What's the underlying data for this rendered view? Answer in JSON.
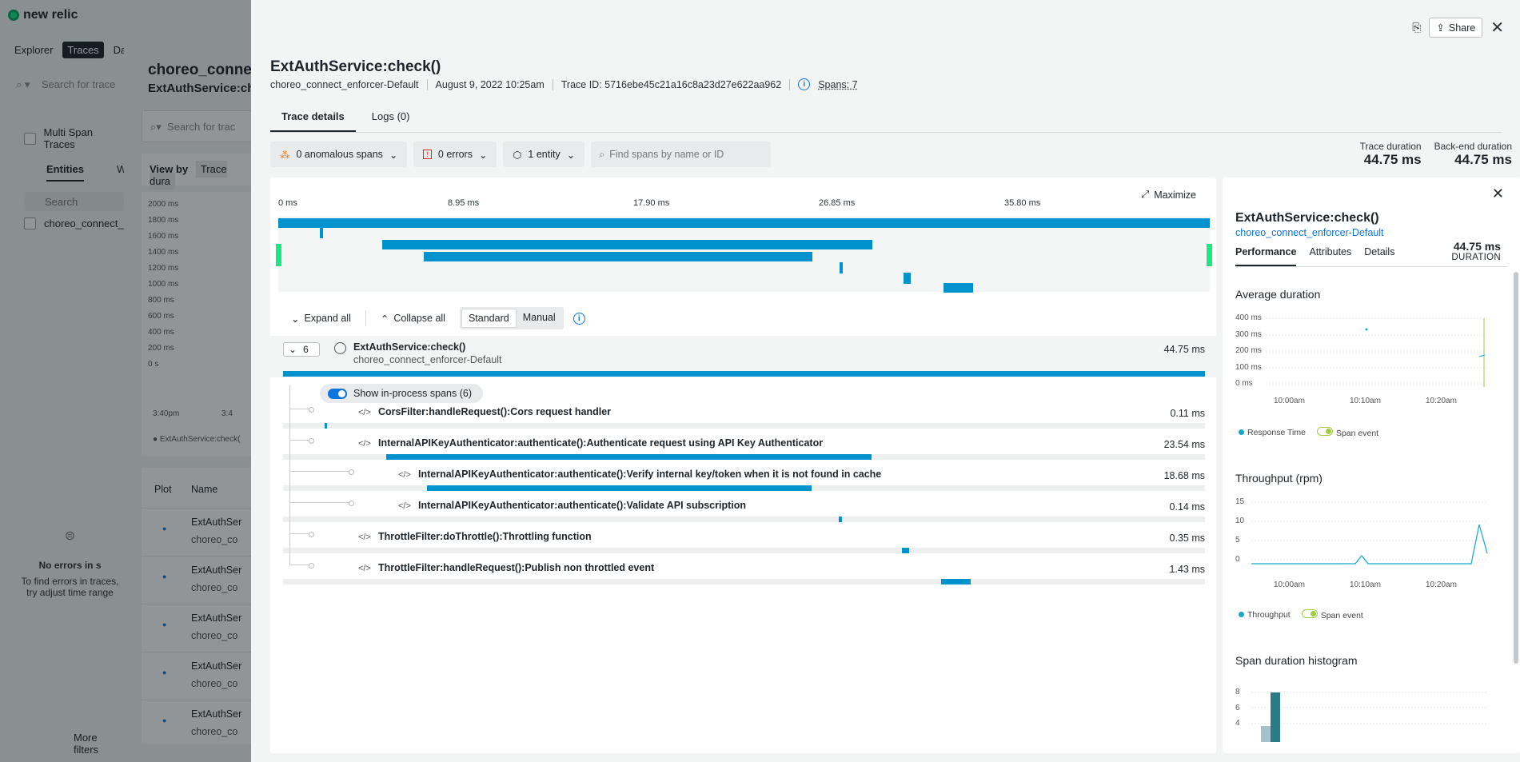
{
  "bg": {
    "logo": "new relic",
    "nav_tabs": [
      "Explorer",
      "Traces",
      "Das"
    ],
    "search_placeholder": "Search for trace",
    "multi_span": "Multi Span Traces",
    "entities_tab": "Entities",
    "entities_tab2": "W",
    "search": "Search",
    "entity_item": "choreo_connect_e",
    "no_errors_title": "No errors in s",
    "no_errors_body": "To find errors in traces, try adjust time range",
    "more_filters": "More filters",
    "page_title": "choreo_connec",
    "page_sub": "ExtAuthService:che",
    "search2": "Search for trac",
    "view_by": "View by",
    "view_by_val": "Trace dura",
    "y_ticks": [
      "2000 ms",
      "1800 ms",
      "1600 ms",
      "1400 ms",
      "1200 ms",
      "1000 ms",
      "800 ms",
      "600 ms",
      "400 ms",
      "200 ms",
      "0 s"
    ],
    "x_ticks": [
      "3:40pm",
      "3:4"
    ],
    "legend": "ExtAuthService:check(",
    "col_plot": "Plot",
    "col_name": "Name",
    "rows": [
      {
        "name": "ExtAuthSer",
        "sub": "choreo_co"
      },
      {
        "name": "ExtAuthSer",
        "sub": "choreo_co"
      },
      {
        "name": "ExtAuthSer",
        "sub": "choreo_co"
      },
      {
        "name": "ExtAuthSer",
        "sub": "choreo_co"
      },
      {
        "name": "ExtAuthSer",
        "sub": "choreo_co"
      }
    ]
  },
  "header": {
    "title": "ExtAuthService:check()",
    "entity": "choreo_connect_enforcer-Default",
    "date": "August 9, 2022 10:25am",
    "trace_id": "Trace ID: 5716ebe45c21a16c8a23d27e622aa962",
    "spans": "Spans: 7",
    "share": "Share"
  },
  "tabs": [
    "Trace details",
    "Logs (0)"
  ],
  "filters": {
    "anomalous": "0 anomalous spans",
    "errors": "0 errors",
    "entity": "1 entity",
    "search_placeholder": "Find spans by name or ID"
  },
  "durations": {
    "trace_label": "Trace duration",
    "trace_val": "44.75 ms",
    "backend_label": "Back-end duration",
    "backend_val": "44.75 ms"
  },
  "ruler": [
    "0 ms",
    "8.95 ms",
    "17.90 ms",
    "26.85 ms",
    "35.80 ms"
  ],
  "maximize": "Maximize",
  "controls": {
    "expand": "Expand all",
    "collapse": "Collapse all",
    "standard": "Standard",
    "manual": "Manual"
  },
  "root": {
    "count": "6",
    "name": "ExtAuthService:check()",
    "sub": "choreo_connect_enforcer-Default",
    "duration": "44.75 ms",
    "toggle": "Show in-process spans (6)"
  },
  "spans": [
    {
      "name": "CorsFilter:handleRequest():Cors request handler",
      "duration": "0.11 ms",
      "start": 0.045,
      "width": 0.003,
      "depth": 1
    },
    {
      "name": "InternalAPIKeyAuthenticator:authenticate():Authenticate request using API Key Authenticator",
      "duration": "23.54 ms",
      "start": 0.112,
      "width": 0.526,
      "depth": 1
    },
    {
      "name": "InternalAPIKeyAuthenticator:authenticate():Verify internal key/token when it is not found in cache",
      "duration": "18.68 ms",
      "start": 0.156,
      "width": 0.417,
      "depth": 2
    },
    {
      "name": "InternalAPIKeyAuthenticator:authenticate():Validate API subscription",
      "duration": "0.14 ms",
      "start": 0.603,
      "width": 0.003,
      "depth": 2
    },
    {
      "name": "ThrottleFilter:doThrottle():Throttling function",
      "duration": "0.35 ms",
      "start": 0.671,
      "width": 0.008,
      "depth": 1
    },
    {
      "name": "ThrottleFilter:handleRequest():Publish non throttled event",
      "duration": "1.43 ms",
      "start": 0.714,
      "width": 0.032,
      "depth": 1
    }
  ],
  "side": {
    "title": "ExtAuthService:check()",
    "entity": "choreo_connect_enforcer-Default",
    "duration": "44.75 ms",
    "duration_label": "DURATION",
    "tabs": [
      "Performance",
      "Attributes",
      "Details"
    ],
    "avg_title": "Average duration",
    "avg_y": [
      "400 ms",
      "300 ms",
      "200 ms",
      "100 ms",
      "0 ms"
    ],
    "avg_x": [
      "10:00am",
      "10:10am",
      "10:20am"
    ],
    "avg_legend": [
      "Response Time",
      "Span event"
    ],
    "thr_title": "Throughput (rpm)",
    "thr_y": [
      "15",
      "10",
      "5",
      "0"
    ],
    "thr_x": [
      "10:00am",
      "10:10am",
      "10:20am"
    ],
    "thr_legend": [
      "Throughput",
      "Span event"
    ],
    "hist_title": "Span duration histogram",
    "hist_y": [
      "8",
      "6",
      "4"
    ]
  }
}
